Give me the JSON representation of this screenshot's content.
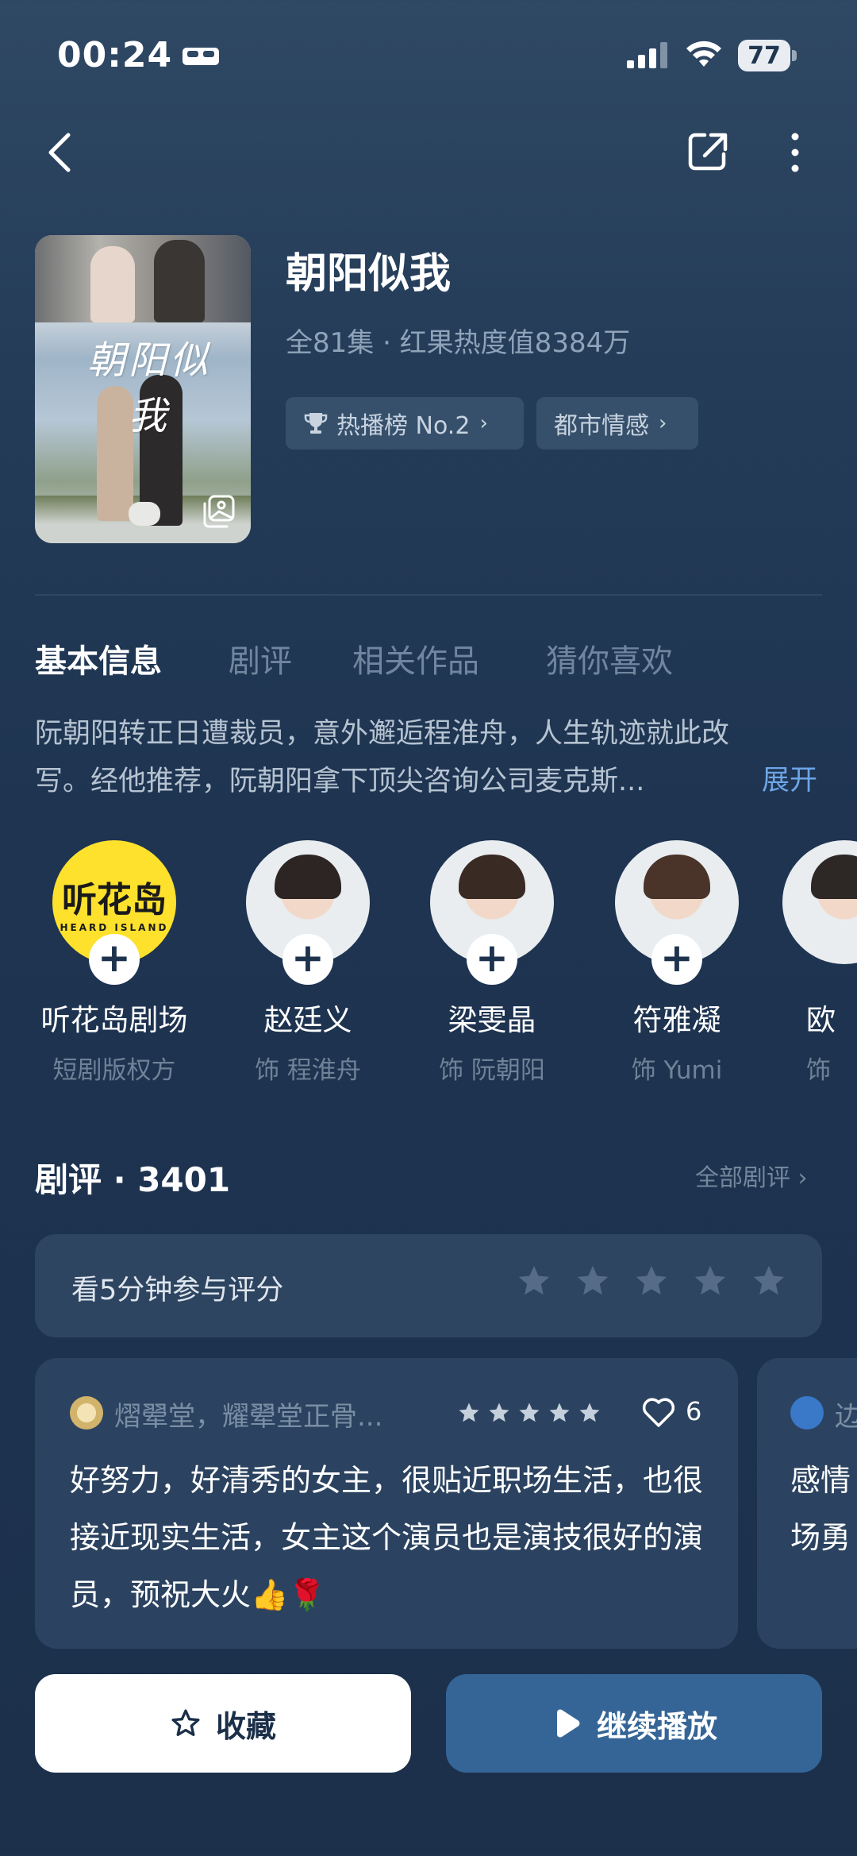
{
  "status": {
    "time": "00:24",
    "battery": "77"
  },
  "drama": {
    "title": "朝阳似我",
    "poster_title": "朝阳似我",
    "meta": "全81集 · 红果热度值8384万",
    "chips": {
      "rank": "热播榜 No.2",
      "genre": "都市情感"
    }
  },
  "tabs": [
    "基本信息",
    "剧评",
    "相关作品",
    "猜你喜欢"
  ],
  "synopsis": {
    "text": "阮朝阳转正日遭裁员，意外邂逅程淮舟，人生轨迹就此改写。经他推荐，阮朝阳拿下顶尖咨询公司麦克斯...",
    "expand": "展开"
  },
  "cast": [
    {
      "name": "听花岛剧场",
      "role": "短剧版权方",
      "logo": "听花岛",
      "logo_sub": "HEARD ISLAND"
    },
    {
      "name": "赵廷义",
      "role": "饰 程淮舟"
    },
    {
      "name": "梁雯晶",
      "role": "饰 阮朝阳"
    },
    {
      "name": "符雅凝",
      "role": "饰 Yumi"
    },
    {
      "name": "欧",
      "role": "饰"
    }
  ],
  "reviews": {
    "heading": "剧评 · 3401",
    "all_label": "全部剧评 ›",
    "rate_prompt": "看5分钟参与评分",
    "items": [
      {
        "user": "熠翚堂，耀翚堂正骨...",
        "likes": "6",
        "text": "好努力，好清秀的女主，很贴近职场生活，也很接近现实生活，女主这个演员也是演技很好的演员，预祝大火👍🌹"
      },
      {
        "user": "边",
        "text_line1": "感情",
        "text_line2": "场勇"
      }
    ]
  },
  "actions": {
    "favorite": "收藏",
    "play": "继续播放"
  },
  "colors": {
    "accent": "#6ea6e6",
    "play_button": "#356597",
    "background": "#1e3451"
  }
}
